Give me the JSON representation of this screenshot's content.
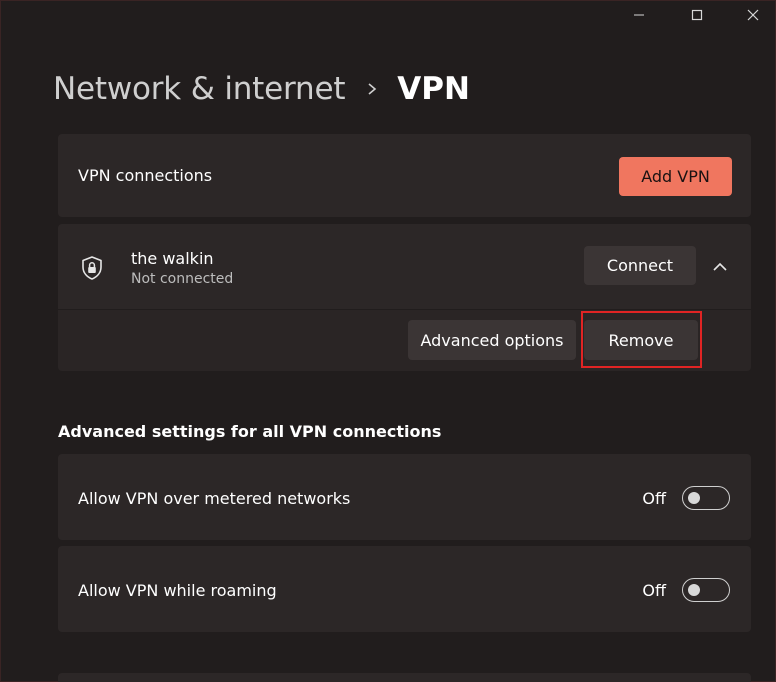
{
  "window": {
    "controls": [
      "minimize-icon",
      "maximize-icon",
      "close-icon"
    ]
  },
  "breadcrumb": {
    "parent": "Network & internet",
    "separator_icon": "chevron-right-icon",
    "current": "VPN"
  },
  "vpn_connections": {
    "label": "VPN connections",
    "add_button": "Add VPN"
  },
  "connection": {
    "icon": "shield-icon",
    "name": "the walkin",
    "status": "Not connected",
    "connect_button": "Connect",
    "expand_icon": "chevron-up-icon",
    "advanced_button": "Advanced options",
    "remove_button": "Remove"
  },
  "advanced_settings": {
    "heading": "Advanced settings for all VPN connections",
    "items": [
      {
        "label": "Allow VPN over metered networks",
        "state_label": "Off",
        "on": false
      },
      {
        "label": "Allow VPN while roaming",
        "state_label": "Off",
        "on": false
      }
    ]
  },
  "colors": {
    "background": "#211d1d",
    "card": "#2c2727",
    "accent": "#f0765f",
    "highlight": "#e02424"
  }
}
